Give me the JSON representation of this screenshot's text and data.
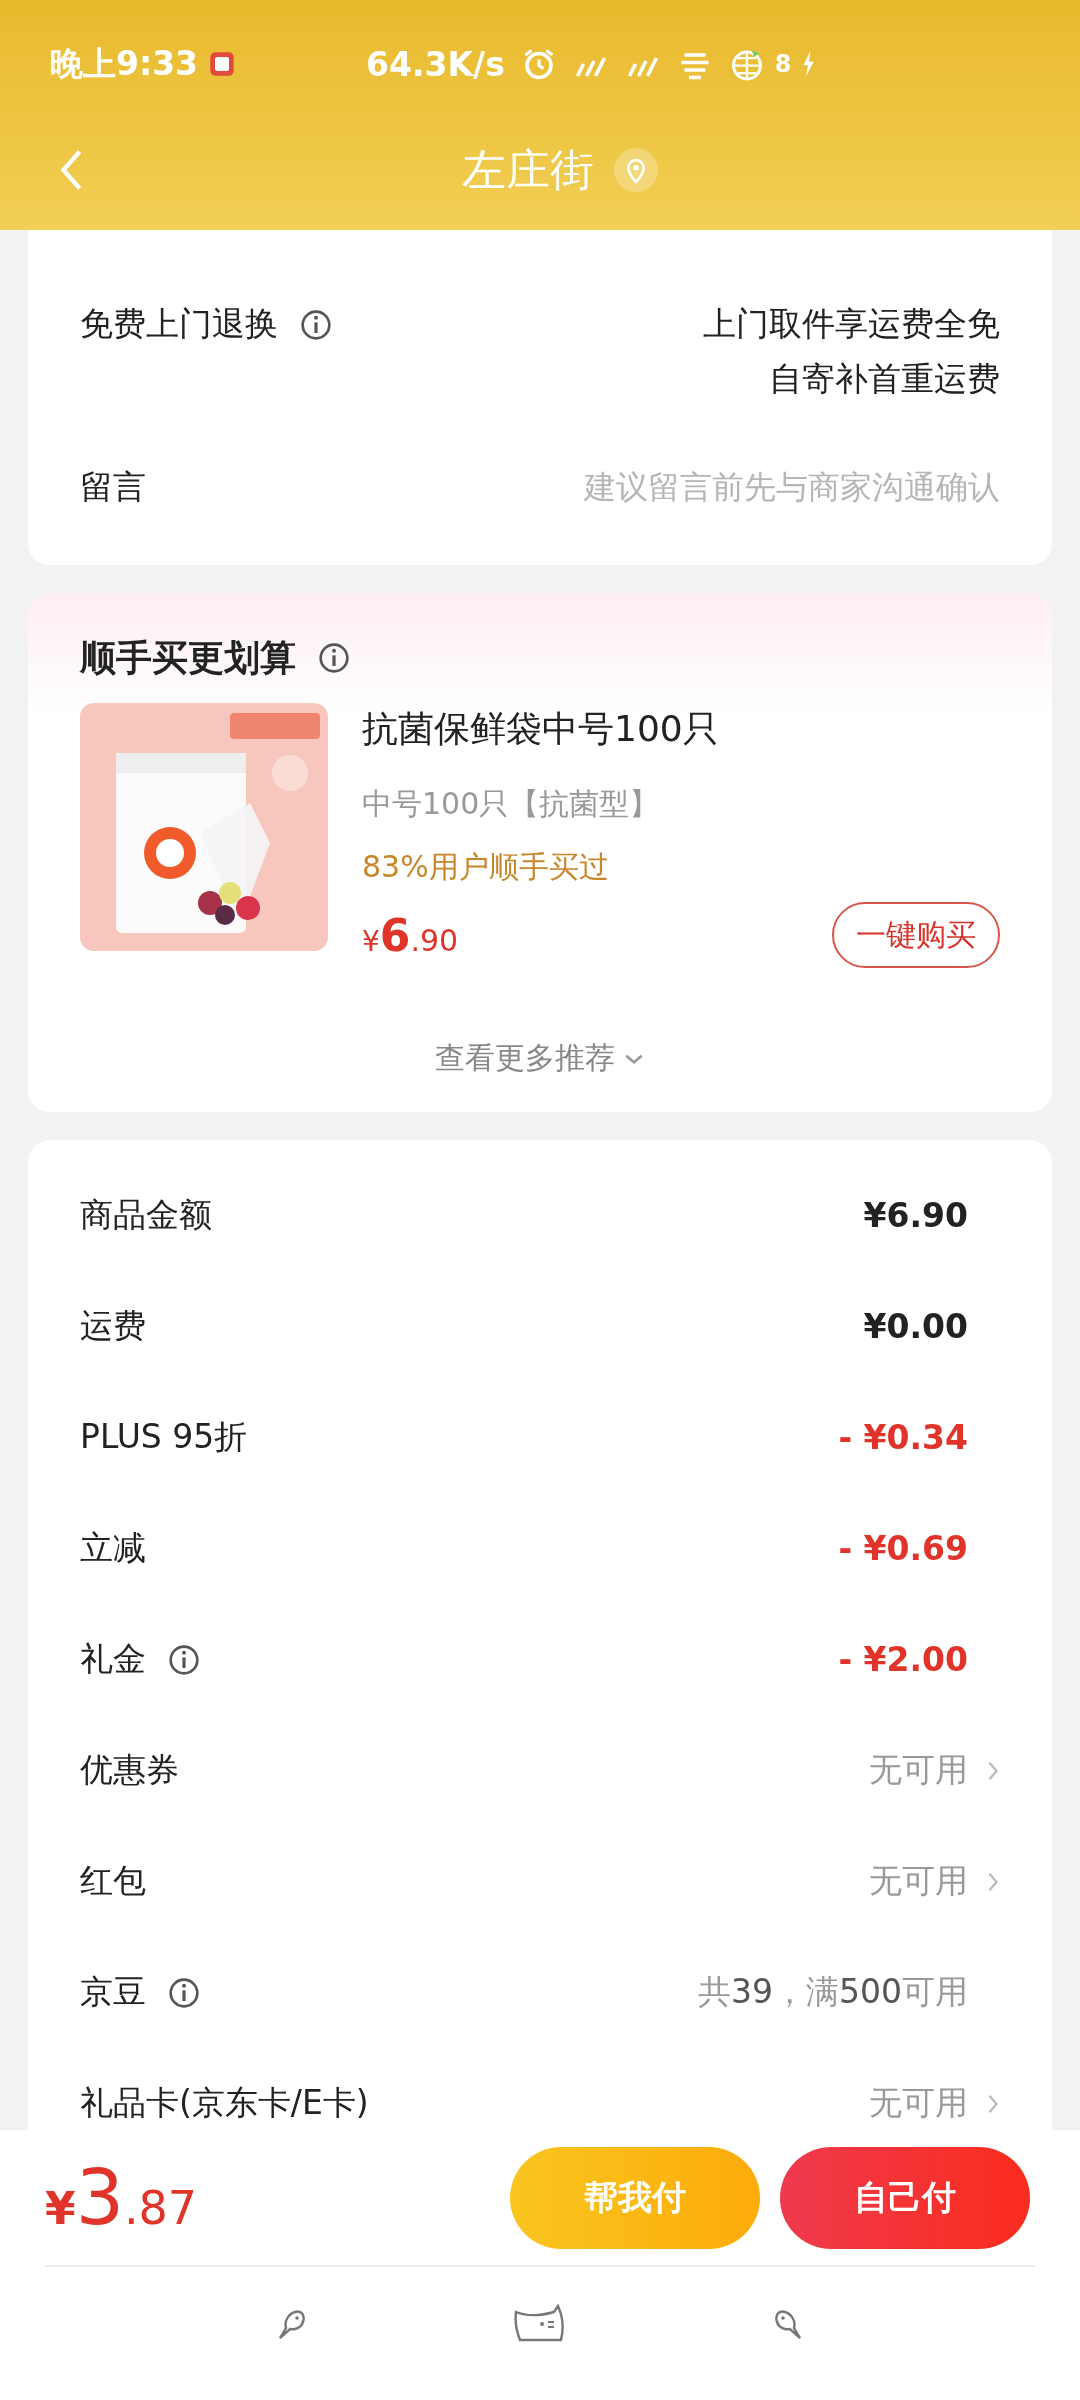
{
  "status_bar": {
    "time": "晚上9:33",
    "speed": "64.3K/s",
    "battery": "8"
  },
  "header": {
    "title": "左庄街"
  },
  "service": {
    "label": "免费上门退换",
    "lines": [
      "上门取件享运费全免",
      "自寄补首重运费"
    ]
  },
  "message": {
    "label": "留言",
    "placeholder": "建议留言前先与商家沟通确认"
  },
  "recommend": {
    "title": "顺手买更划算",
    "product": {
      "kind": "picture",
      "name": "抗菌保鲜袋中号100只",
      "spec": "中号100只【抗菌型】",
      "note": "83%用户顺手买过",
      "price_symbol": "¥",
      "price_int": "6",
      "price_dec": ".90",
      "button": "一键购买"
    },
    "more": "查看更多推荐"
  },
  "summary": [
    {
      "label": "商品金额",
      "value": "¥6.90",
      "kind": "amount",
      "info": false
    },
    {
      "label": "运费",
      "value": "¥0.00",
      "kind": "amount",
      "info": false
    },
    {
      "label": "PLUS 95折",
      "value": "- ¥0.34",
      "kind": "discount",
      "info": false
    },
    {
      "label": "立减",
      "value": "- ¥0.69",
      "kind": "discount",
      "info": false
    },
    {
      "label": "礼金",
      "value": "- ¥2.00",
      "kind": "discount",
      "info": true
    },
    {
      "label": "优惠券",
      "value": "无可用",
      "kind": "option",
      "info": false
    },
    {
      "label": "红包",
      "value": "无可用",
      "kind": "option",
      "info": false
    },
    {
      "label": "京豆",
      "value": "共**39**，满**500**可用",
      "kind": "plain",
      "info": true
    },
    {
      "label": "礼品卡(京东卡/E卡)",
      "value": "无可用",
      "kind": "option",
      "info": false
    }
  ],
  "total": {
    "symbol": "¥",
    "int": "3",
    "dec": ".87"
  },
  "buttons": [
    {
      "label": "帮我付",
      "kind": "friend"
    },
    {
      "label": "自己付",
      "kind": "self"
    }
  ]
}
